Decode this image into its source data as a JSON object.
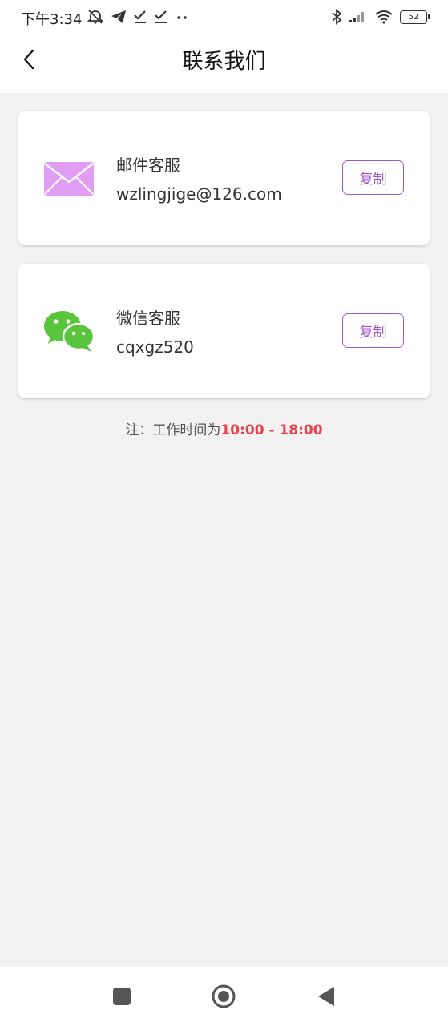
{
  "status_bar": {
    "time": "下午3:34",
    "battery_level": "52",
    "left_icons": [
      "mute-bell-icon",
      "telegram-icon",
      "check-icon",
      "check-icon",
      "more-dots-icon"
    ],
    "right_icons": [
      "bluetooth-icon",
      "signal-icon",
      "wifi-icon",
      "battery-icon"
    ]
  },
  "header": {
    "title": "联系我们",
    "back_icon": "back-arrow-icon"
  },
  "contacts": [
    {
      "icon": "mail-icon",
      "title": "邮件客服",
      "value": "wzlingjige@126.com",
      "button_label": "复制"
    },
    {
      "icon": "wechat-icon",
      "title": "微信客服",
      "value": "cqxgz520",
      "button_label": "复制"
    }
  ],
  "note": {
    "prefix": "注：工作时间为",
    "hours": "10:00 - 18:00"
  },
  "nav_bar": {
    "icons": [
      "recent-apps-icon",
      "home-icon",
      "back-triangle-icon"
    ]
  },
  "colors": {
    "accent": "#a456c8",
    "mail_icon": "#e19cf3",
    "wechat_icon": "#58c53c",
    "hours": "#e8424a",
    "background": "#f2f2f2"
  }
}
